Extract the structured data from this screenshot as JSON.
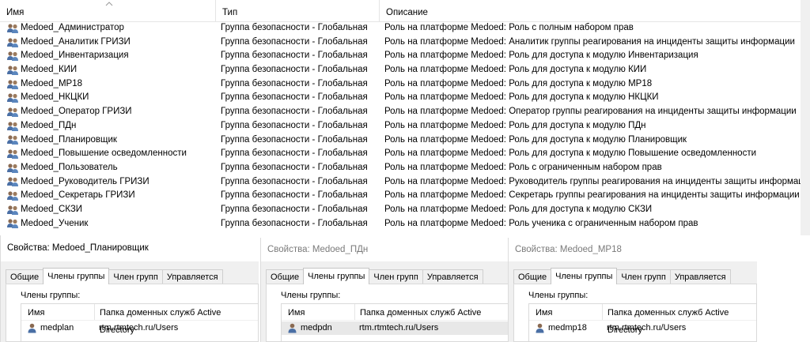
{
  "listview": {
    "columns": {
      "name": "Имя",
      "type": "Тип",
      "description": "Описание"
    },
    "rows": [
      {
        "name": "Medoed_Администратор",
        "type": "Группа безопасности - Глобальная",
        "description": "Роль на платформе Medoed: Роль с полным набором прав"
      },
      {
        "name": "Medoed_Аналитик ГРИЗИ",
        "type": "Группа безопасности - Глобальная",
        "description": "Роль на платформе Medoed: Аналитик группы реагирования на инциденты защиты информации"
      },
      {
        "name": "Medoed_Инвентаризация",
        "type": "Группа безопасности - Глобальная",
        "description": "Роль на платформе Medoed: Роль для доступа к модулю Инвентаризация"
      },
      {
        "name": "Medoed_КИИ",
        "type": "Группа безопасности - Глобальная",
        "description": "Роль на платформе Medoed: Роль для доступа к модулю КИИ"
      },
      {
        "name": "Medoed_МР18",
        "type": "Группа безопасности - Глобальная",
        "description": "Роль на платформе Medoed: Роль для доступа к модулю МР18"
      },
      {
        "name": "Medoed_НКЦКИ",
        "type": "Группа безопасности - Глобальная",
        "description": "Роль на платформе Medoed: Роль для доступа к модулю НКЦКИ"
      },
      {
        "name": "Medoed_Оператор ГРИЗИ",
        "type": "Группа безопасности - Глобальная",
        "description": "Роль на платформе Medoed: Оператор группы реагирования на инциденты защиты информации"
      },
      {
        "name": "Medoed_ПДн",
        "type": "Группа безопасности - Глобальная",
        "description": "Роль на платформе Medoed: Роль для доступа к модулю ПДн"
      },
      {
        "name": "Medoed_Планировщик",
        "type": "Группа безопасности - Глобальная",
        "description": "Роль на платформе Medoed: Роль для доступа к модулю Планировщик"
      },
      {
        "name": "Medoed_Повышение осведомленности",
        "type": "Группа безопасности - Глобальная",
        "description": "Роль на платформе Medoed: Роль для доступа к модулю Повышение осведомленности"
      },
      {
        "name": "Medoed_Пользователь",
        "type": "Группа безопасности - Глобальная",
        "description": "Роль на платформе Medoed: Роль с ограниченным набором прав"
      },
      {
        "name": "Medoed_Руководитель ГРИЗИ",
        "type": "Группа безопасности - Глобальная",
        "description": "Роль на платформе Medoed: Руководитель группы реагирования на инциденты защиты информации"
      },
      {
        "name": "Medoed_Секретарь ГРИЗИ",
        "type": "Группа безопасности - Глобальная",
        "description": "Роль на платформе Medoed: Секретарь группы реагирования на инциденты защиты информации"
      },
      {
        "name": "Medoed_СКЗИ",
        "type": "Группа безопасности - Глобальная",
        "description": "Роль на платформе Medoed: Роль для доступа к модулю СКЗИ"
      },
      {
        "name": "Medoed_Ученик",
        "type": "Группа безопасности - Глобальная",
        "description": "Роль на платформе Medoed: Роль ученика с ограниченным набором прав"
      }
    ]
  },
  "dialogs": [
    {
      "title": "Свойства: Medoed_Планировщик",
      "tabs": [
        "Общие",
        "Члены группы",
        "Член групп",
        "Управляется"
      ],
      "active_tab": 1,
      "members_label": "Члены группы:",
      "table_headers": [
        "Имя",
        "Папка доменных служб Active Directory"
      ],
      "members": [
        {
          "name": "medplan",
          "folder": "rtm.rtmtech.ru/Users"
        }
      ]
    },
    {
      "title": "Свойства: Medoed_ПДн",
      "tabs": [
        "Общие",
        "Члены группы",
        "Член групп",
        "Управляется"
      ],
      "active_tab": 1,
      "members_label": "Члены группы:",
      "table_headers": [
        "Имя",
        "Папка доменных служб Active Directory"
      ],
      "members": [
        {
          "name": "medpdn",
          "folder": "rtm.rtmtech.ru/Users"
        }
      ]
    },
    {
      "title": "Свойства: Medoed_МР18",
      "tabs": [
        "Общие",
        "Члены группы",
        "Член групп",
        "Управляется"
      ],
      "active_tab": 1,
      "members_label": "Члены группы:",
      "table_headers": [
        "Имя",
        "Папка доменных служб Active Directory"
      ],
      "members": [
        {
          "name": "medmp18",
          "folder": "rtm.rtmtech.ru/Users"
        }
      ]
    }
  ]
}
